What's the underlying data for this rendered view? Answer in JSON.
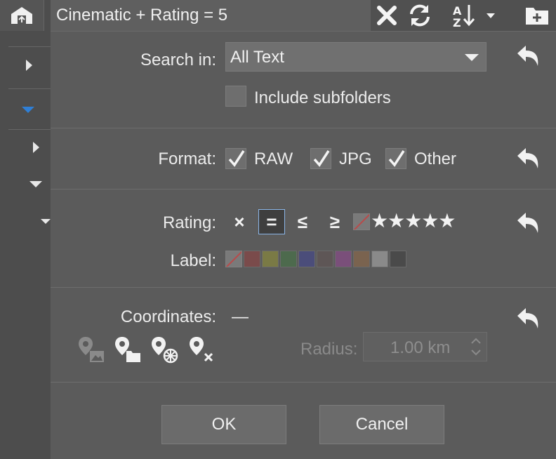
{
  "title": "Cinematic + Rating = 5",
  "search": {
    "label": "Search in:",
    "selected": "All Text",
    "include_subfolders_label": "Include subfolders",
    "include_subfolders_checked": false
  },
  "format": {
    "label": "Format:",
    "options": [
      {
        "label": "RAW",
        "checked": true
      },
      {
        "label": "JPG",
        "checked": true
      },
      {
        "label": "Other",
        "checked": true
      }
    ]
  },
  "rating": {
    "label": "Rating:",
    "operators": [
      "×",
      "=",
      "≤",
      "≥"
    ],
    "selected_operator": "=",
    "stars": "★★★★★",
    "value": 5
  },
  "label_filter": {
    "label": "Label:",
    "colors": [
      "#7a4b4b",
      "#7a7a45",
      "#4d6a4d",
      "#4b4d7a",
      "#5e5656",
      "#7a4f7a",
      "#7a634f",
      "#8a8a8a",
      "#4a4a4a"
    ]
  },
  "coordinates": {
    "label": "Coordinates:",
    "value": "—",
    "radius_label": "Radius:",
    "radius_value": "1.00 km"
  },
  "buttons": {
    "ok": "OK",
    "cancel": "Cancel"
  },
  "icons": {
    "close": "close-icon",
    "refresh": "refresh-icon",
    "sort": "sort-az-icon",
    "new_folder": "add-folder-icon",
    "undo": "undo-icon"
  },
  "colors": {
    "accent": "#2f7fd6",
    "selection_border": "#8bb6e8"
  }
}
